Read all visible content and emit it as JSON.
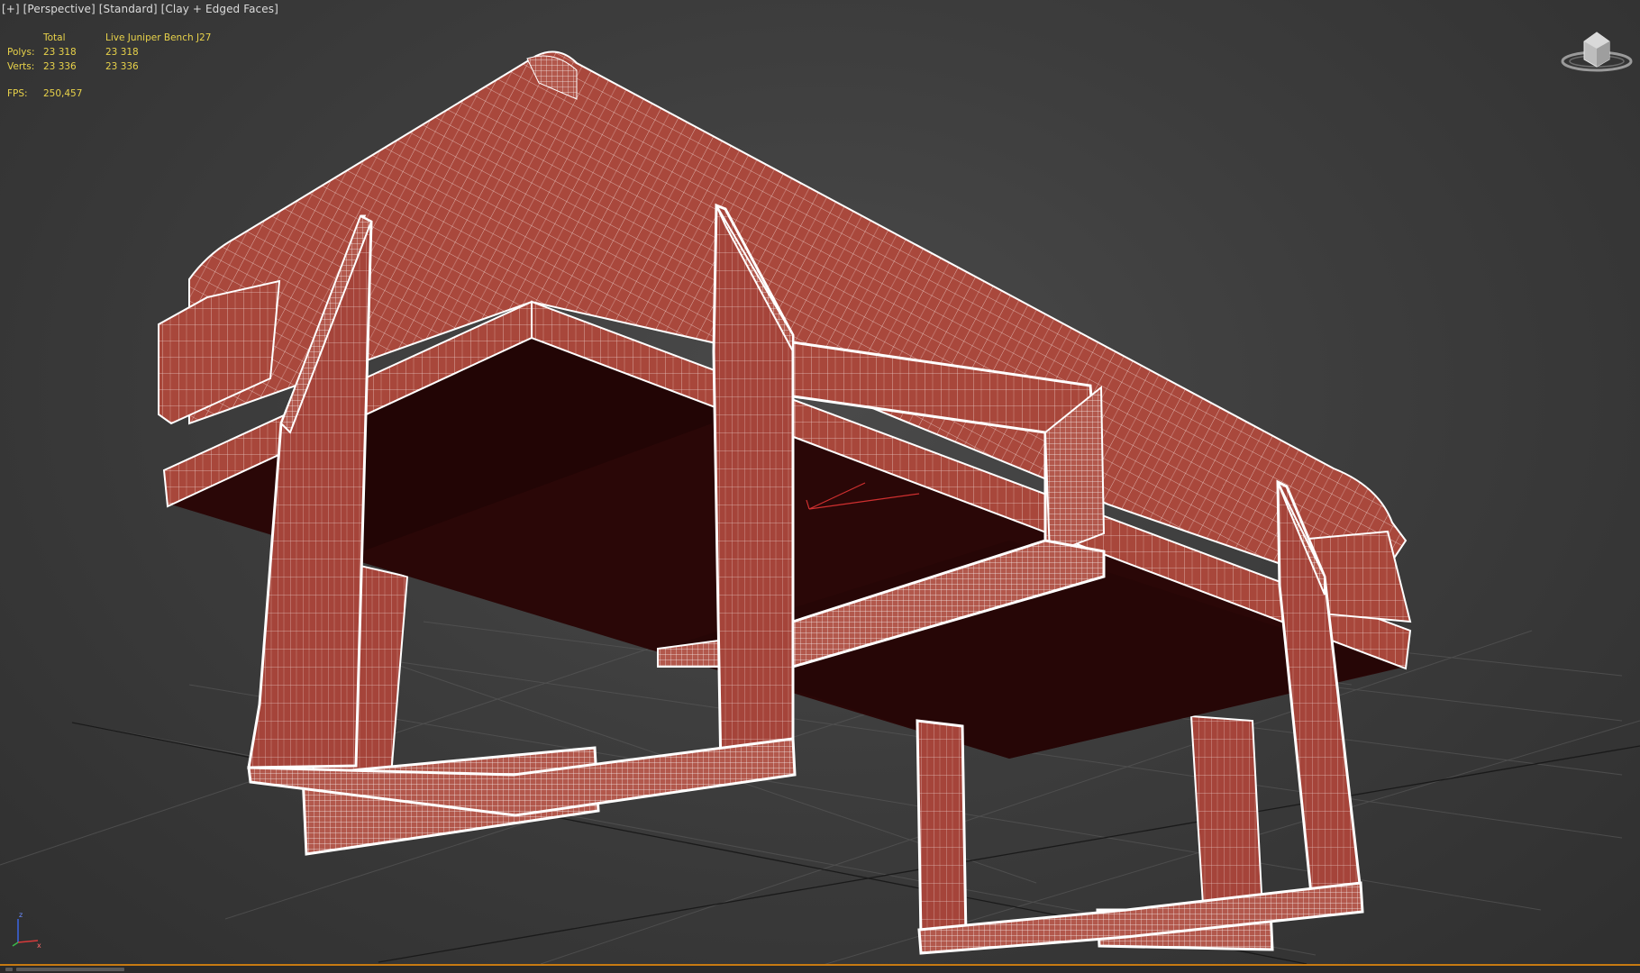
{
  "viewport": {
    "label_parts": [
      "[+]",
      "[Perspective]",
      "[Standard]",
      "[Clay + Edged Faces]"
    ],
    "stats": {
      "header_total": "Total",
      "header_object": "Live Juniper Bench J27",
      "rows": [
        {
          "label": "Polys:",
          "total": "23 318",
          "object": "23 318"
        },
        {
          "label": "Verts:",
          "total": "23 336",
          "object": "23 336"
        }
      ]
    },
    "fps": {
      "label": "FPS:",
      "value": "250,457"
    },
    "viewcube_icon": "viewcube-icon",
    "axis_icon": "axis-tripod-icon",
    "axis_labels": {
      "z": "z",
      "x": "x"
    }
  },
  "colors": {
    "background": "#3d3d3d",
    "clay_face": "#a8473b",
    "dark_face": "#2a0707",
    "wire": "#ffffff",
    "stats_text": "#e8d24a",
    "accent_bar": "#c77a12"
  }
}
